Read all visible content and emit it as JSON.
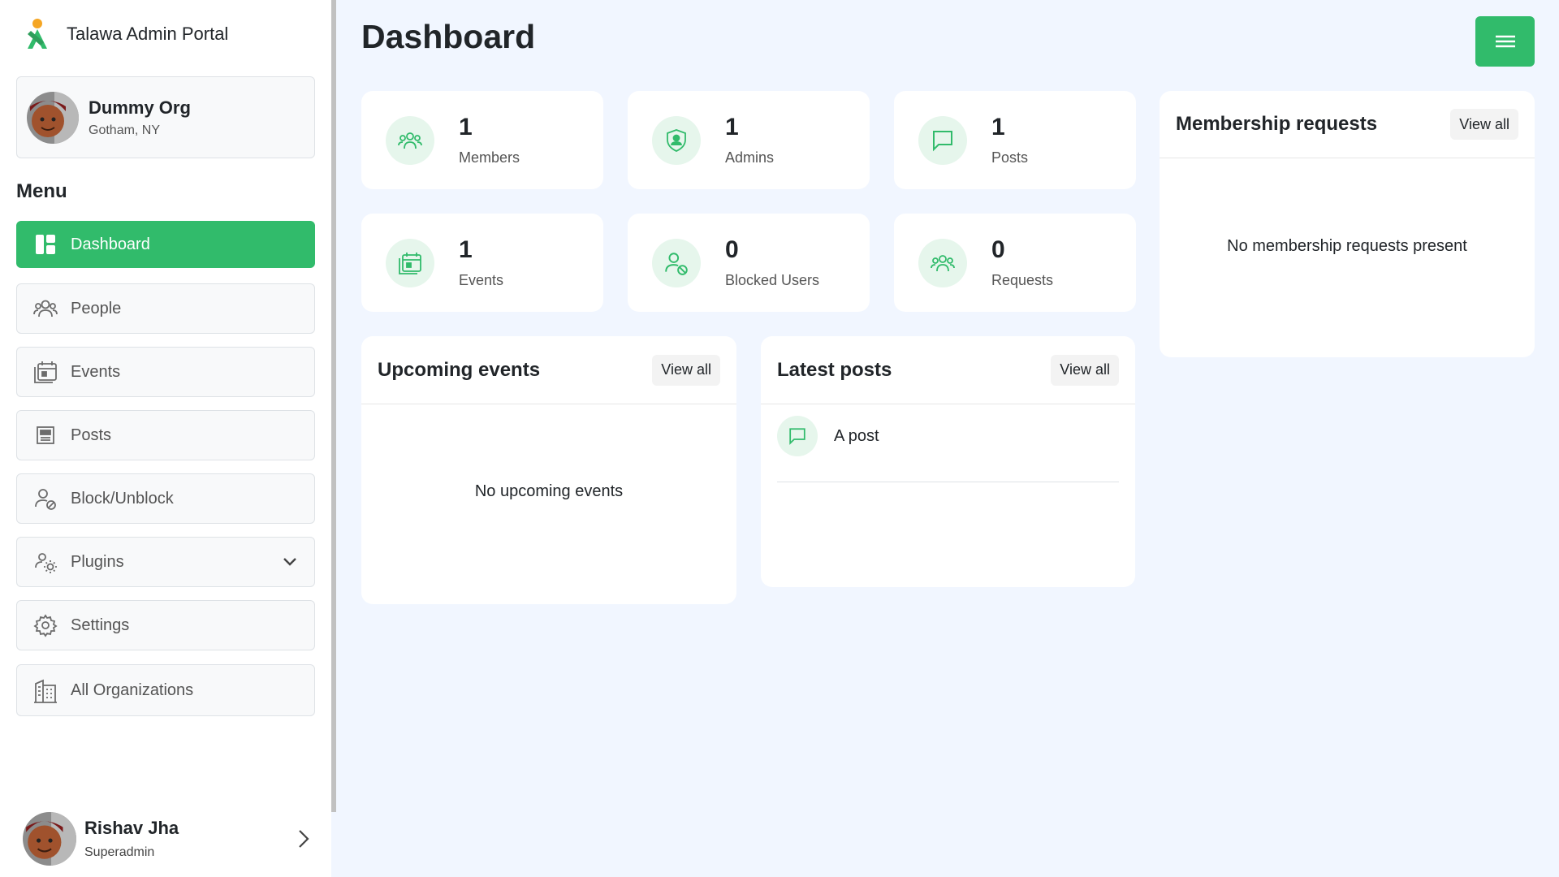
{
  "brand": {
    "title": "Talawa Admin Portal",
    "logo_icon": "talawa-logo-icon"
  },
  "org": {
    "name": "Dummy Org",
    "location": "Gotham, NY"
  },
  "menu": {
    "title": "Menu",
    "items": [
      {
        "label": "Dashboard",
        "icon": "dashboard-icon",
        "active": true
      },
      {
        "label": "People",
        "icon": "people-icon"
      },
      {
        "label": "Events",
        "icon": "events-calendar-icon"
      },
      {
        "label": "Posts",
        "icon": "posts-icon"
      },
      {
        "label": "Block/Unblock",
        "icon": "block-user-icon"
      },
      {
        "label": "Plugins",
        "icon": "plugins-icon",
        "expandable": true
      },
      {
        "label": "Settings",
        "icon": "gear-icon"
      },
      {
        "label": "All Organizations",
        "icon": "building-icon"
      }
    ]
  },
  "profile": {
    "name": "Rishav Jha",
    "role": "Superadmin"
  },
  "page": {
    "title": "Dashboard"
  },
  "stats": [
    {
      "value": "1",
      "label": "Members",
      "icon": "members-icon"
    },
    {
      "value": "1",
      "label": "Admins",
      "icon": "admin-shield-icon"
    },
    {
      "value": "1",
      "label": "Posts",
      "icon": "chat-bubble-icon"
    },
    {
      "value": "1",
      "label": "Events",
      "icon": "events-calendar-icon"
    },
    {
      "value": "0",
      "label": "Blocked Users",
      "icon": "blocked-user-icon"
    },
    {
      "value": "0",
      "label": "Requests",
      "icon": "requests-icon"
    }
  ],
  "upcoming_events": {
    "title": "Upcoming events",
    "view_all": "View all",
    "empty": "No upcoming events"
  },
  "latest_posts": {
    "title": "Latest posts",
    "view_all": "View all",
    "items": [
      {
        "title": "A post"
      }
    ]
  },
  "membership_requests": {
    "title": "Membership requests",
    "view_all": "View all",
    "empty": "No membership requests present"
  },
  "colors": {
    "accent": "#31bb6b",
    "background": "#f1f6ff",
    "icon_bg": "#e6f6ec"
  }
}
